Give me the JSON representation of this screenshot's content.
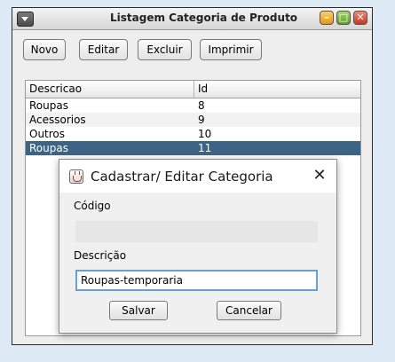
{
  "main_window": {
    "title": "Listagem Categoria de Produto",
    "toolbar": {
      "novo": "Novo",
      "editar": "Editar",
      "excluir": "Excluir",
      "imprimir": "Imprimir"
    },
    "table": {
      "columns": [
        "Descricao",
        "Id"
      ],
      "rows": [
        {
          "descricao": "Roupas",
          "id": "8"
        },
        {
          "descricao": "Acessorios",
          "id": "9"
        },
        {
          "descricao": "Outros",
          "id": "10"
        },
        {
          "descricao": "Roupas",
          "id": "11",
          "selected": true
        }
      ]
    }
  },
  "dialog": {
    "title": "Cadastrar/ Editar Categoria",
    "codigo_label": "Código",
    "codigo_value": "",
    "descricao_label": "Descrição",
    "descricao_value": "Roupas-temporaria",
    "salvar": "Salvar",
    "cancelar": "Cancelar"
  },
  "colors": {
    "selected_row": "#3d6385",
    "focus_border": "#6b9fd0"
  }
}
